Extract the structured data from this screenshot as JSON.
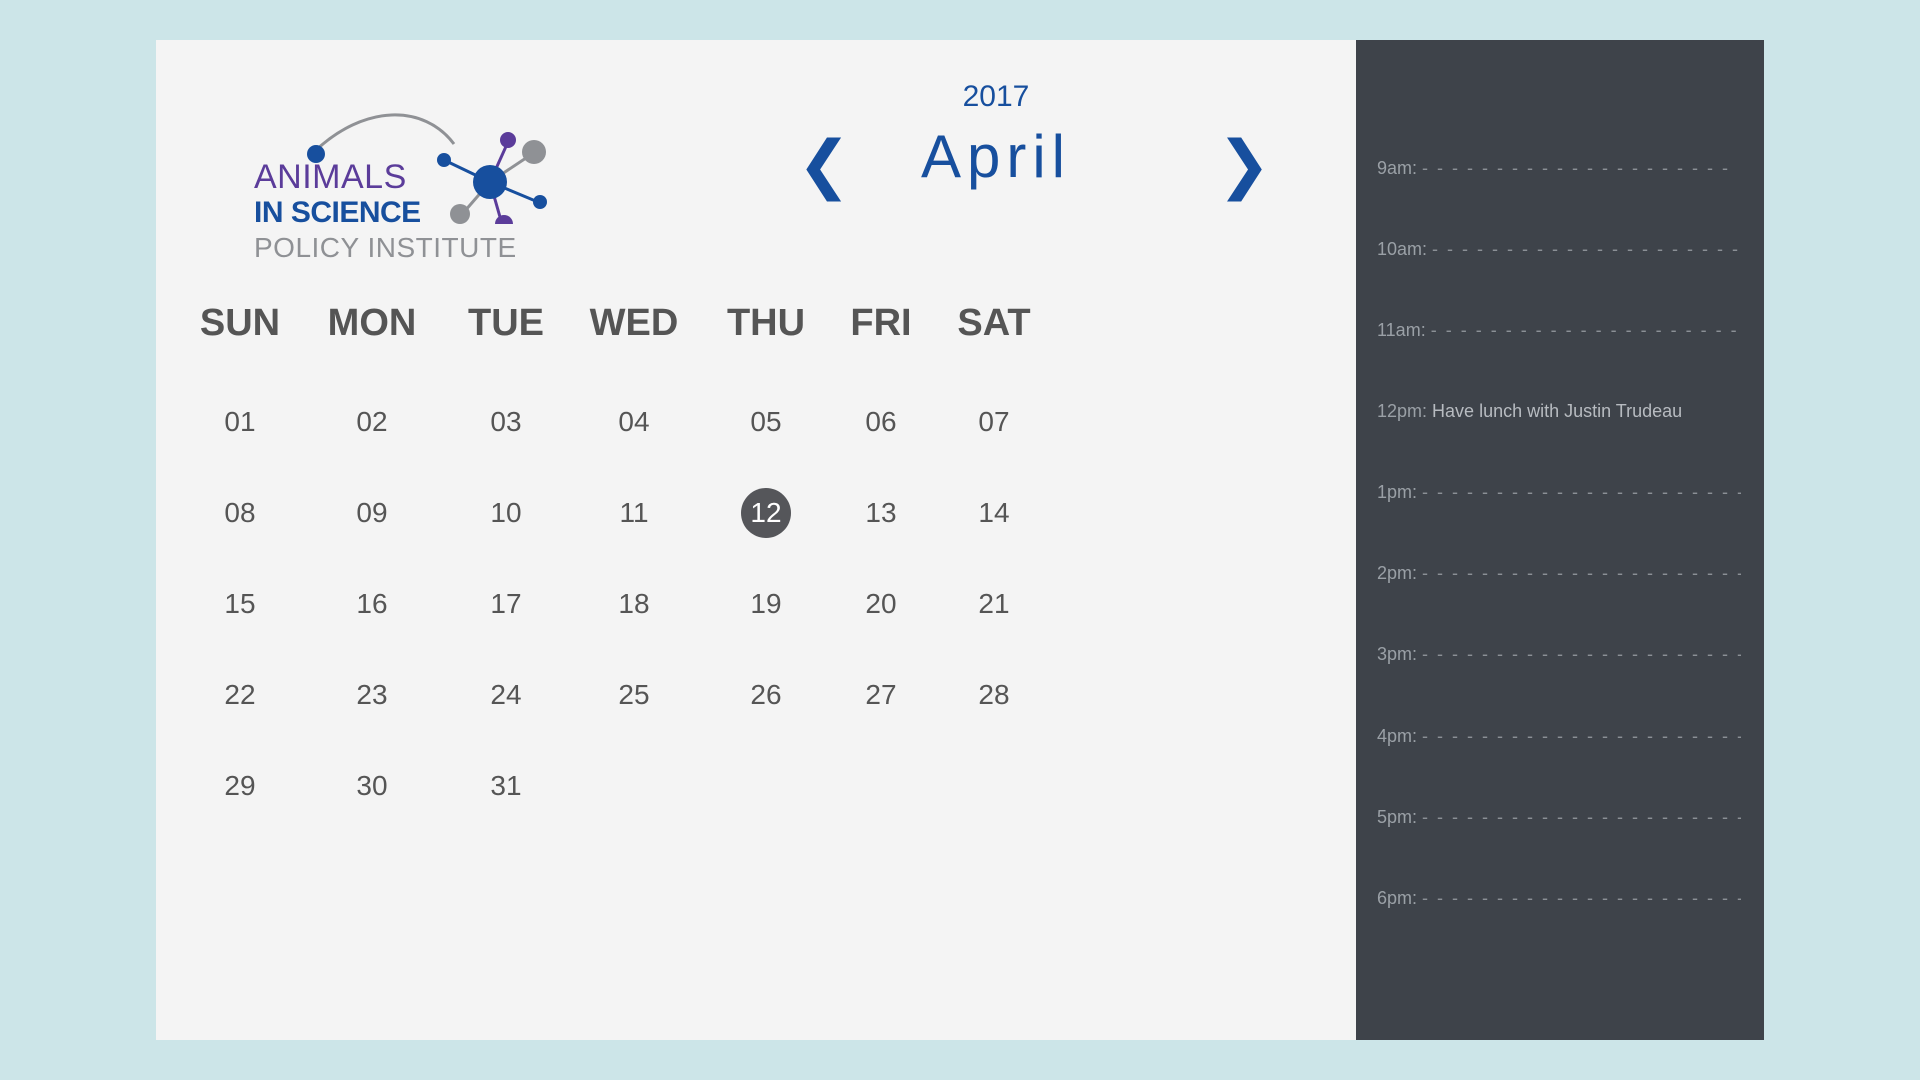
{
  "logo": {
    "line1": "ANIMALS",
    "line2": "IN SCIENCE",
    "line3": "POLICY INSTITUTE"
  },
  "header": {
    "year": "2017",
    "month": "April",
    "prev_icon": "chevron-left-icon",
    "next_icon": "chevron-right-icon"
  },
  "weekdays": [
    "SUN",
    "MON",
    "TUE",
    "WED",
    "THU",
    "FRI",
    "SAT"
  ],
  "days": [
    [
      "01",
      "02",
      "03",
      "04",
      "05",
      "06",
      "07"
    ],
    [
      "08",
      "09",
      "10",
      "11",
      "12",
      "13",
      "14"
    ],
    [
      "15",
      "16",
      "17",
      "18",
      "19",
      "20",
      "21"
    ],
    [
      "22",
      "23",
      "24",
      "25",
      "26",
      "27",
      "28"
    ],
    [
      "29",
      "30",
      "31",
      "",
      "",
      "",
      ""
    ]
  ],
  "selected_day": "12",
  "schedule": [
    {
      "time": "9am:",
      "event": "",
      "dashes": "- - - - - - - - - - - - - - - - - - - - -"
    },
    {
      "time": "10am:",
      "event": "",
      "dashes": "- - - - - - - - - - - - - - -  - - - - - -"
    },
    {
      "time": "11am:",
      "event": "",
      "dashes": "- - - - - - - - - - - - - - - - - - - - -"
    },
    {
      "time": "12pm:",
      "event": "Have lunch with Justin Trudeau",
      "dashes": ""
    },
    {
      "time": "1pm:",
      "event": "",
      "dashes": "- - - - - - - - - - - - - - - - - - - - - -"
    },
    {
      "time": "2pm:",
      "event": "",
      "dashes": "- - - - - - - - - - - - - - - - - - - - - -"
    },
    {
      "time": "3pm:",
      "event": "",
      "dashes": "- - - - - - - - - - - - - - - - - - - - - -"
    },
    {
      "time": "4pm:",
      "event": "",
      "dashes": "- - - - - - - - - - - - - - - - - - - - - -"
    },
    {
      "time": "5pm:",
      "event": "",
      "dashes": "- - - - - - - - - - - - - - - - - - - - - -"
    },
    {
      "time": "6pm:",
      "event": "",
      "dashes": "- - - - - - - - - - - - - - - - - - - - - -"
    }
  ],
  "colors": {
    "background": "#cce5e8",
    "card": "#f4f4f4",
    "sidebar": "#3e434a",
    "accent": "#174f9e",
    "logo_purple": "#5b3c9a",
    "logo_gray": "#8f9195",
    "selected": "#55565a"
  }
}
